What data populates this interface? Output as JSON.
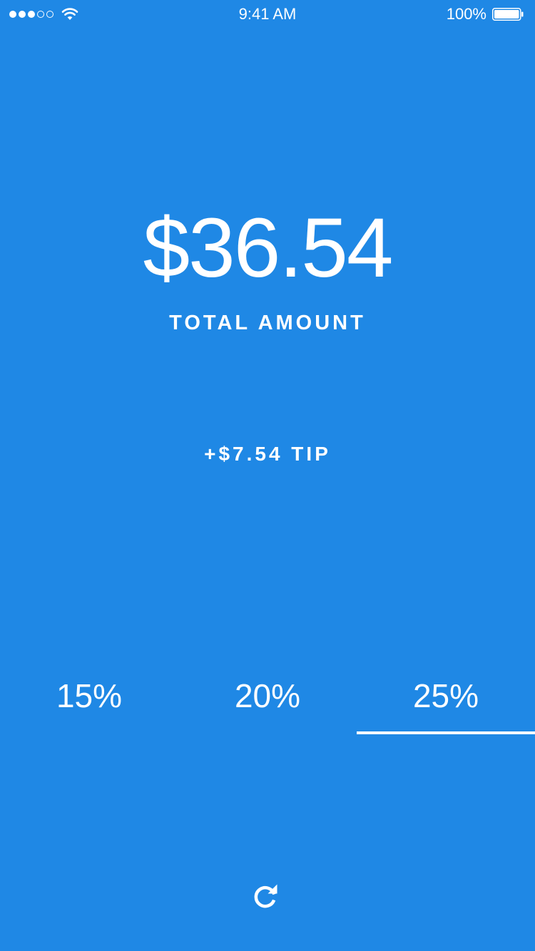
{
  "status_bar": {
    "time": "9:41 AM",
    "battery_percent": "100%",
    "signal_bars_filled": 3,
    "signal_bars_total": 5,
    "icons": [
      "signal-dots-icon",
      "wifi-icon",
      "battery-icon"
    ]
  },
  "summary": {
    "total_amount": "$36.54",
    "total_label": "TOTAL AMOUNT",
    "tip_label": "+$7.54 TIP"
  },
  "tip_options": [
    {
      "label": "15%",
      "selected": false
    },
    {
      "label": "20%",
      "selected": false
    },
    {
      "label": "25%",
      "selected": true
    }
  ],
  "reset": {
    "icon": "refresh-icon"
  },
  "colors": {
    "background": "#1f88e5",
    "foreground": "#ffffff"
  }
}
